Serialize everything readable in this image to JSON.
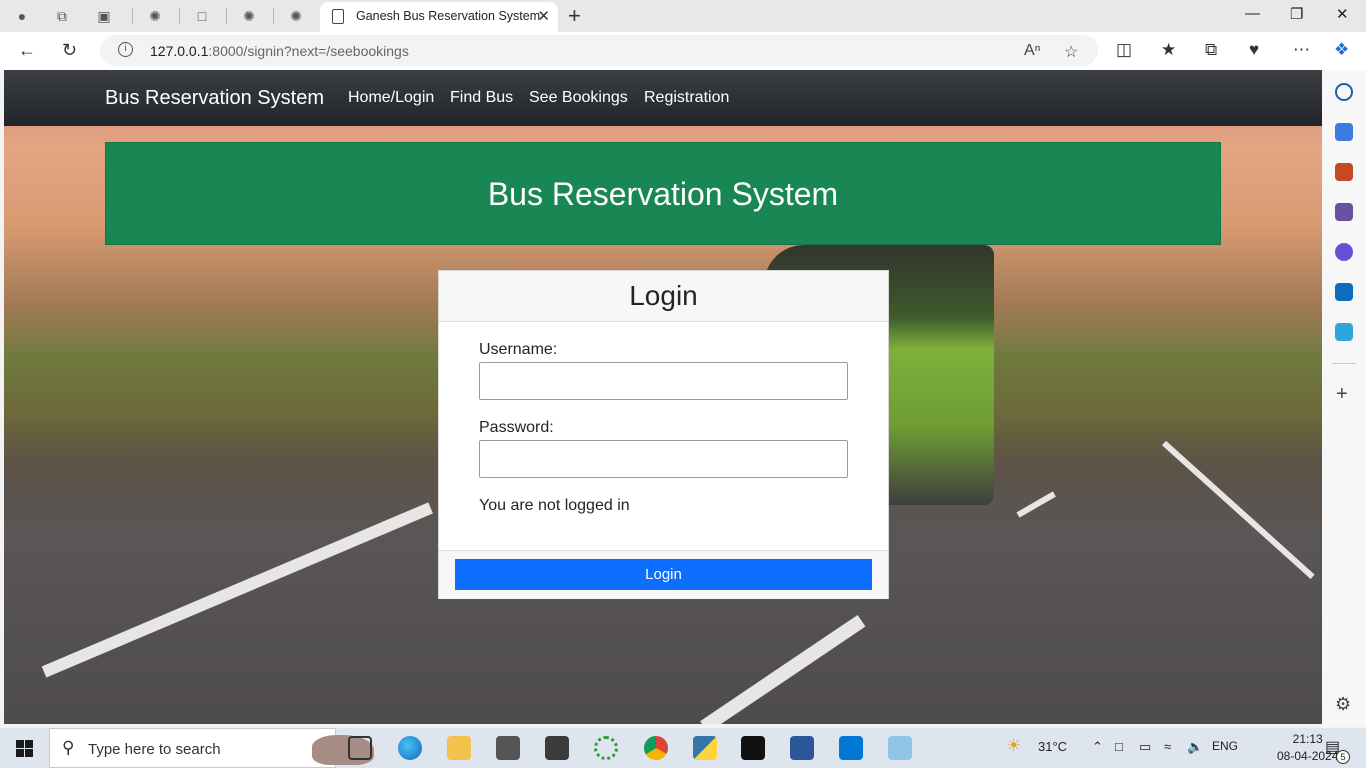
{
  "browser": {
    "active_tab_title": "Ganesh Bus Reservation System",
    "url_host": "127.0.0.1",
    "url_rest": ":8000/signin?next=/seebookings"
  },
  "site": {
    "brand": "Bus Reservation System",
    "nav": [
      "Home/Login",
      "Find Bus",
      "See Bookings",
      "Registration"
    ],
    "banner_title": "Bus Reservation System"
  },
  "login": {
    "title": "Login",
    "username_label": "Username:",
    "username_value": "",
    "password_label": "Password:",
    "password_value": "",
    "status": "You are not logged in",
    "button": "Login"
  },
  "taskbar": {
    "search_placeholder": "Type here to search",
    "weather": "31°C",
    "language": "ENG",
    "time": "21:13",
    "date": "08-04-2024",
    "notifications": "5"
  },
  "colors": {
    "banner": "#198754",
    "button": "#0d6efd",
    "nav": "#212529"
  }
}
